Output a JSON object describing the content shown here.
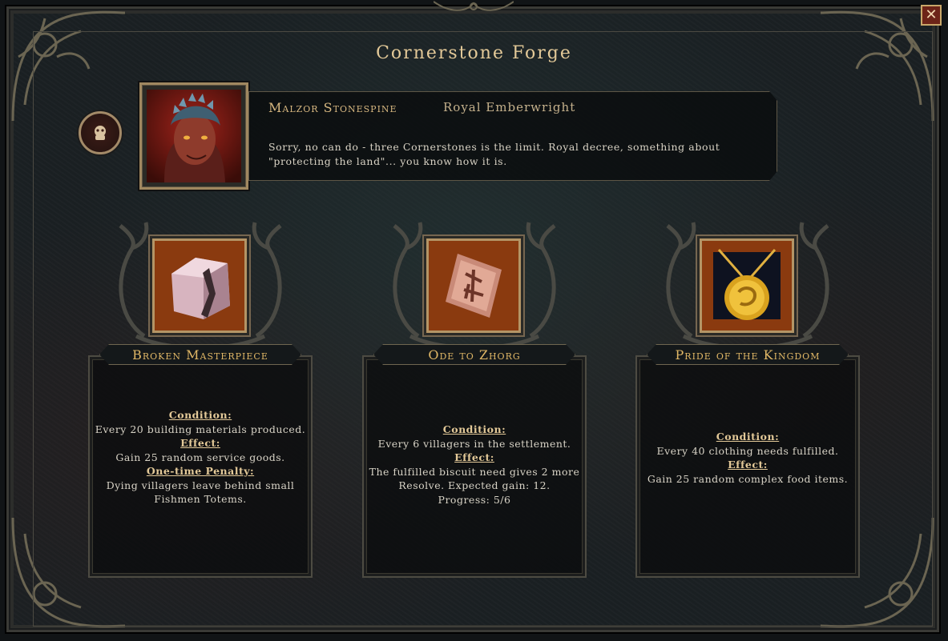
{
  "window": {
    "title": "Cornerstone Forge",
    "close_label": "✕"
  },
  "dialog": {
    "speaker": "Malzor Stonespine",
    "role": "Royal Emberwright",
    "quote": "Sorry, no can do - three Cornerstones is the limit. Royal decree, something about \"protecting the land\"... you know how it is."
  },
  "cards": [
    {
      "name": "Broken Masterpiece",
      "icon": "broken-stone-block-icon",
      "condition_label": "Condition:",
      "condition": "Every 20 building materials produced.",
      "effect_label": "Effect:",
      "effect": "Gain 25 random service goods.",
      "penalty_label": "One-time Penalty:",
      "penalty": "Dying villagers leave behind small Fishmen Totems."
    },
    {
      "name": "Ode to Zhorg",
      "icon": "rune-stone-icon",
      "condition_label": "Condition:",
      "condition": "Every 6 villagers in the settlement.",
      "effect_label": "Effect:",
      "effect": "The fulfilled biscuit need gives 2 more Resolve. Expected gain: 12.",
      "progress": "Progress: 5/6"
    },
    {
      "name": "Pride of the Kingdom",
      "icon": "gold-medallion-icon",
      "condition_label": "Condition:",
      "condition": "Every 40 clothing needs fulfilled.",
      "effect_label": "Effect:",
      "effect": "Gain 25 random complex food items."
    }
  ],
  "colors": {
    "accent_gold": "#e0b766",
    "frame": "#4d4b42",
    "icon_bg": "#8a3a0f"
  }
}
